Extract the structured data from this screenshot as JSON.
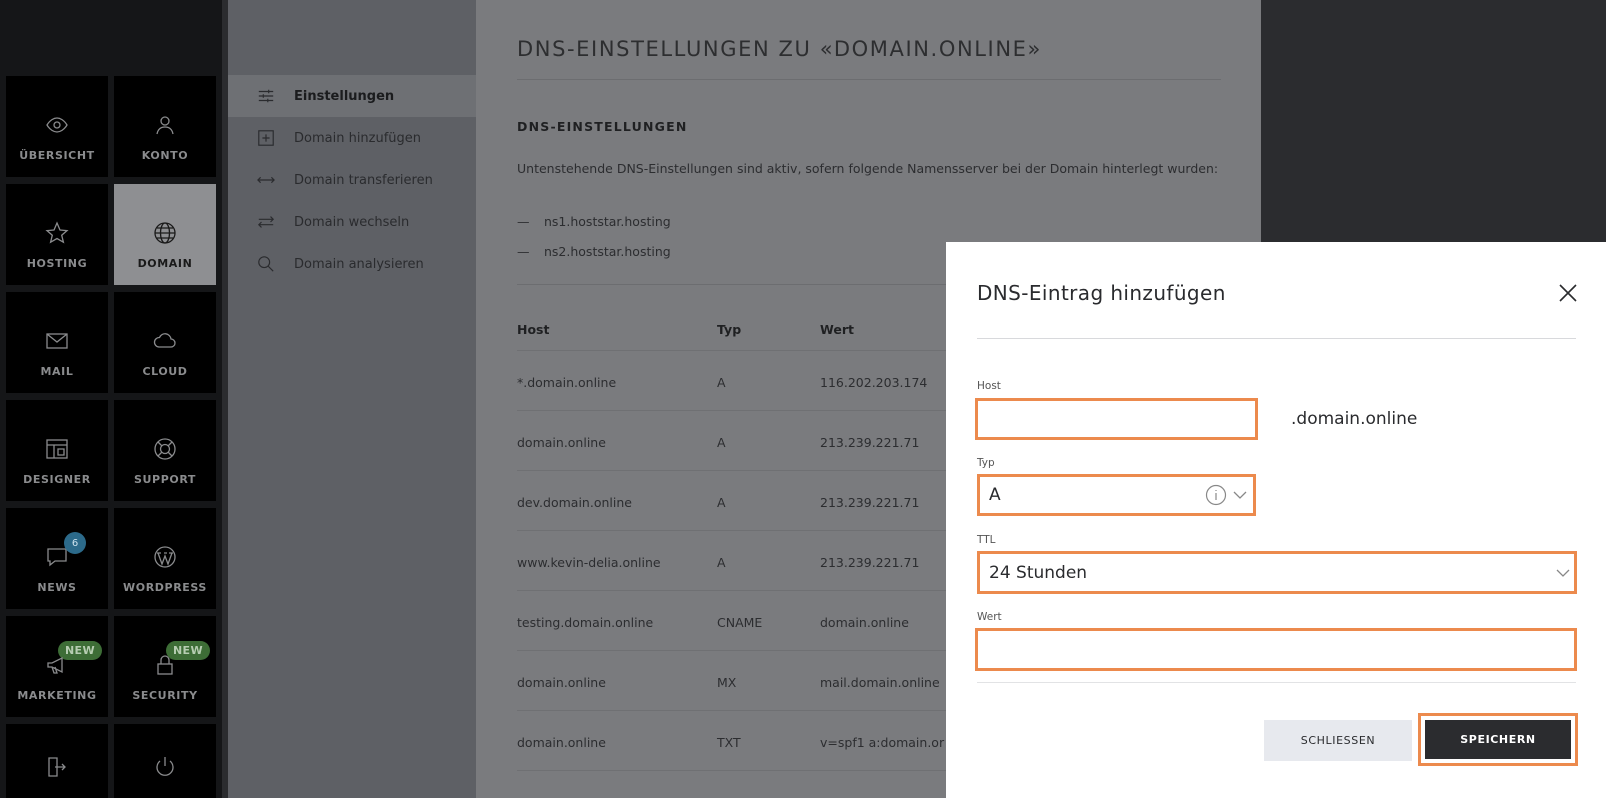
{
  "tiles": [
    {
      "label": "ÜBERSICHT",
      "icon": "eye-icon"
    },
    {
      "label": "KONTO",
      "icon": "user-icon"
    },
    {
      "label": "HOSTING",
      "icon": "star-icon"
    },
    {
      "label": "DOMAIN",
      "icon": "globe-icon"
    },
    {
      "label": "MAIL",
      "icon": "envelope-icon"
    },
    {
      "label": "CLOUD",
      "icon": "cloud-icon"
    },
    {
      "label": "DESIGNER",
      "icon": "layout-icon"
    },
    {
      "label": "SUPPORT",
      "icon": "lifebuoy-icon"
    },
    {
      "label": "NEWS",
      "icon": "chat-icon",
      "badge": "6"
    },
    {
      "label": "WORDPRESS",
      "icon": "wordpress-icon"
    },
    {
      "label": "MARKETING",
      "icon": "megaphone-icon",
      "badge": "NEW"
    },
    {
      "label": "SECURITY",
      "icon": "lock-icon",
      "badge": "NEW"
    }
  ],
  "subnav": [
    {
      "label": "Einstellungen",
      "icon": "sliders-icon"
    },
    {
      "label": "Domain hinzufügen",
      "icon": "plus-square-icon"
    },
    {
      "label": "Domain transferieren",
      "icon": "arrows-horizontal-icon"
    },
    {
      "label": "Domain wechseln",
      "icon": "swap-icon"
    },
    {
      "label": "Domain analysieren",
      "icon": "search-icon"
    }
  ],
  "main": {
    "title": "DNS-EINSTELLUNGEN ZU «DOMAIN.ONLINE»",
    "section_title": "DNS-EINSTELLUNGEN",
    "description": "Untenstehende DNS-Einstellungen sind aktiv, sofern folgende Namensserver bei der Domain hinterlegt wurden:",
    "nameservers": [
      "ns1.hoststar.hosting",
      "ns2.hoststar.hosting"
    ],
    "table": {
      "headers": [
        "Host",
        "Typ",
        "Wert"
      ],
      "rows": [
        [
          "*.domain.online",
          "A",
          "116.202.203.174"
        ],
        [
          "domain.online",
          "A",
          "213.239.221.71"
        ],
        [
          "dev.domain.online",
          "A",
          "213.239.221.71"
        ],
        [
          "www.kevin-delia.online",
          "A",
          "213.239.221.71"
        ],
        [
          "testing.domain.online",
          "CNAME",
          "domain.online"
        ],
        [
          "domain.online",
          "MX",
          "mail.domain.online"
        ],
        [
          "domain.online",
          "TXT",
          "v=spf1 a:domain.or"
        ]
      ]
    }
  },
  "modal": {
    "title": "DNS-Eintrag hinzufügen",
    "host_label": "Host",
    "host_value": "",
    "host_suffix": ".domain.online",
    "typ_label": "Typ",
    "typ_value": "A",
    "ttl_label": "TTL",
    "ttl_value": "24 Stunden",
    "wert_label": "Wert",
    "wert_value": "",
    "close_label": "SCHLIESSEN",
    "save_label": "SPEICHERN"
  },
  "colors": {
    "highlight": "#ec8a4d",
    "primary_button": "#2b2c2f"
  }
}
